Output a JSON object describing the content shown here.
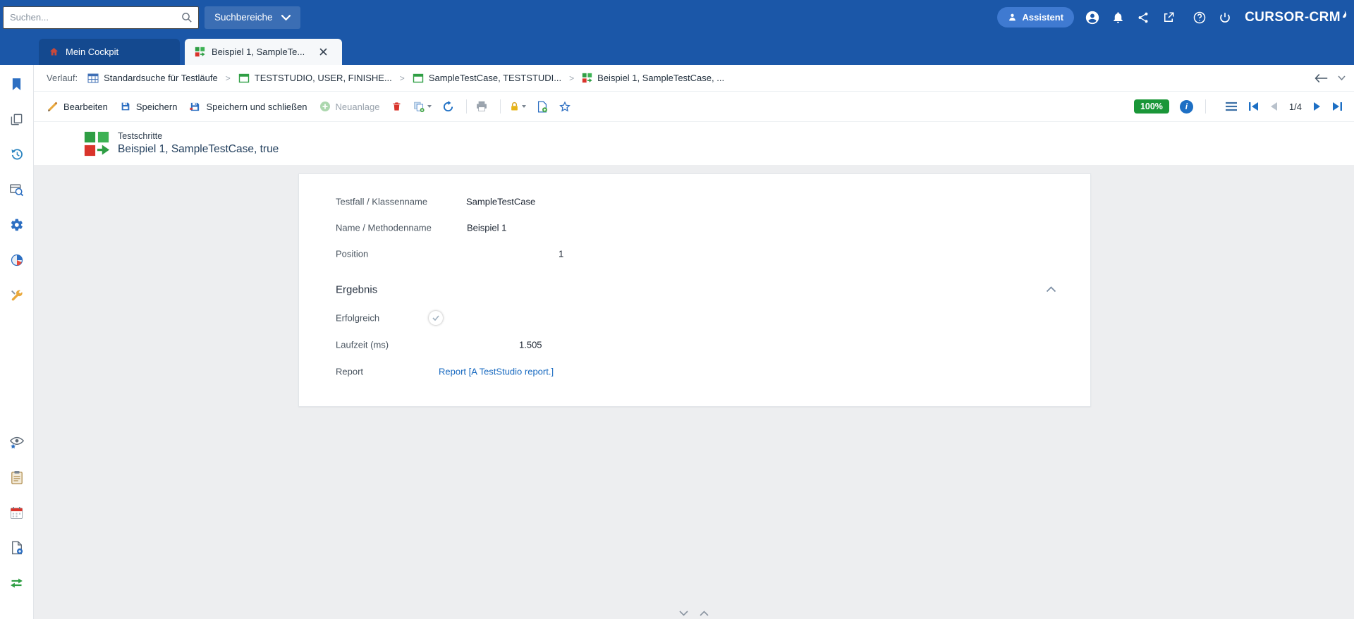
{
  "colors": {
    "topbar_blue": "#1b57a8",
    "accent_blue": "#1d6fc4",
    "link_blue": "#1769c0",
    "badge_green": "#1a9638",
    "toggle_track": "#b3c3d3",
    "danger_red": "#d9342b",
    "success_green": "#2f9e44"
  },
  "topbar": {
    "search_placeholder": "Suchen...",
    "search_areas": "Suchbereiche",
    "assistant": "Assistent",
    "brand": "CURSOR-CRM",
    "icons": [
      "person",
      "account-circle",
      "notifications-bell",
      "share",
      "open-external",
      "help",
      "power"
    ]
  },
  "tabs": [
    {
      "label": "Mein Cockpit",
      "icon": "home",
      "active": false
    },
    {
      "label": "Beispiel 1, SampleTe...",
      "icon": "teststep",
      "active": true,
      "closable": true
    }
  ],
  "breadcrumb": {
    "label": "Verlauf:",
    "items": [
      {
        "label": "Standardsuche für Testläufe",
        "icon": "table-search"
      },
      {
        "label": "TESTSTUDIO, USER, FINISHE...",
        "icon": "green-window"
      },
      {
        "label": "SampleTestCase, TESTSTUDI...",
        "icon": "green-window"
      },
      {
        "label": "Beispiel 1, SampleTestCase, ...",
        "icon": "teststep"
      }
    ],
    "nav_icons": [
      "arrow-back",
      "chevron-down"
    ]
  },
  "toolbar": {
    "edit": "Bearbeiten",
    "save": "Speichern",
    "save_and_close": "Speichern und schließen",
    "new": "Neuanlage",
    "new_enabled": false,
    "icon_buttons": [
      "delete",
      "copy-dropdown",
      "refresh",
      "print",
      "lock-dropdown",
      "document-add",
      "favorite-star"
    ],
    "zoom": "100%",
    "right_icons": [
      "info",
      "menu",
      "first-page",
      "previous-page",
      "next-page",
      "last-page"
    ],
    "page_indicator": "1/4"
  },
  "record": {
    "type_label": "Testschritte",
    "title": "Beispiel 1, SampleTestCase, true"
  },
  "form": {
    "fields": [
      {
        "label": "Testfall / Klassenname",
        "value": "SampleTestCase"
      },
      {
        "label": "Name / Methodenname",
        "value": "Beispiel 1"
      },
      {
        "label": "Position",
        "value": "1"
      }
    ],
    "section_title": "Ergebnis",
    "result": {
      "toggle_label": "Erfolgreich",
      "toggle_on": true,
      "runtime_label": "Laufzeit (ms)",
      "runtime_value": "1.505",
      "report_label": "Report",
      "report_link": "Report [A TestStudio report.]"
    }
  },
  "sidebar": {
    "icons": [
      "bookmark",
      "pages",
      "history",
      "search-window",
      "settings-gear",
      "pie-chart",
      "tools-wrench",
      "eye-star",
      "clipboard",
      "calendar",
      "document-new",
      "sync-arrows"
    ]
  },
  "bottom_controls": [
    "chevron-down",
    "chevron-up"
  ]
}
